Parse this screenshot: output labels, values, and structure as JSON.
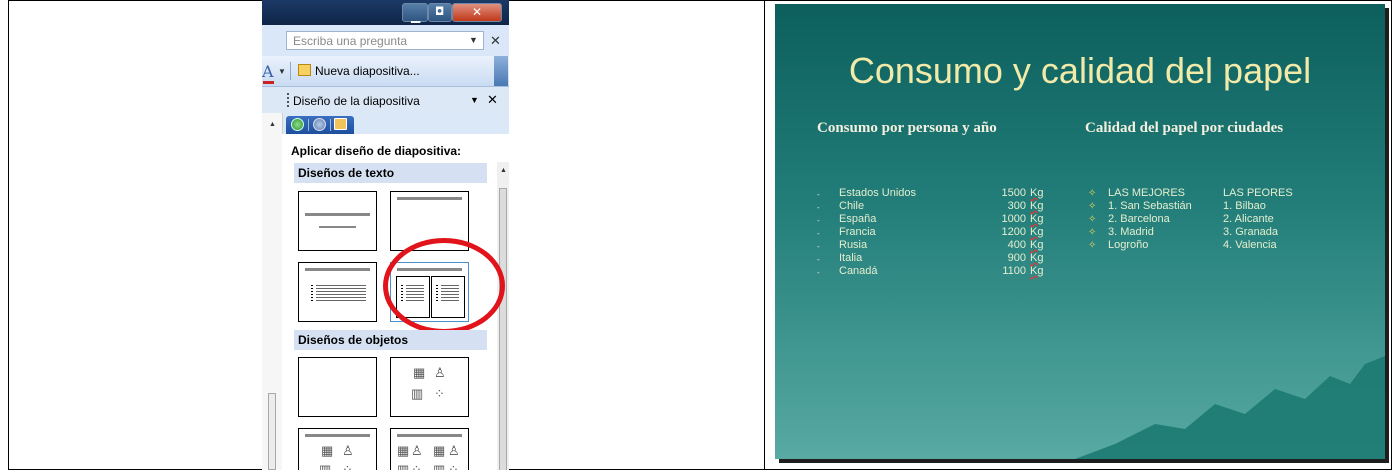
{
  "pane": {
    "ask_placeholder": "Escriba una pregunta",
    "new_slide_label": "Nueva diapositiva...",
    "pane_title": "Diseño de la diapositiva",
    "apply_label": "Aplicar diseño de diapositiva:",
    "section_text": "Diseños de texto",
    "section_objects": "Diseños de objetos",
    "toolbar_font_letter": "A"
  },
  "slide": {
    "title": "Consumo y calidad del papel",
    "left_heading": "Consumo por persona y año",
    "right_heading": "Calidad del papel por ciudades",
    "consumption": [
      {
        "country": "Estados Unidos",
        "amount": "1500",
        "unit": "Kg"
      },
      {
        "country": "Chile",
        "amount": "300",
        "unit": "Kg"
      },
      {
        "country": "España",
        "amount": "1000",
        "unit": "Kg"
      },
      {
        "country": "Francia",
        "amount": "1200",
        "unit": "Kg"
      },
      {
        "country": "Rusia",
        "amount": "400",
        "unit": "Kg"
      },
      {
        "country": "Italia",
        "amount": "900",
        "unit": "Kg"
      },
      {
        "country": "Canadá",
        "amount": "1100",
        "unit": "Kg"
      }
    ],
    "best_header": "LAS MEJORES",
    "worst_header": "LAS PEORES",
    "best": [
      "1. San Sebastián",
      "2. Barcelona",
      "3. Madrid",
      "Logroño"
    ],
    "worst": [
      "1. Bilbao",
      "2. Alicante",
      "3. Granada",
      "4. Valencia"
    ]
  },
  "colors": {
    "highlight_ring": "#e0141a",
    "slide_title": "#f2eaa8",
    "slide_bg_top": "#0c5f5d",
    "slide_bg_bottom": "#58aaa3"
  }
}
